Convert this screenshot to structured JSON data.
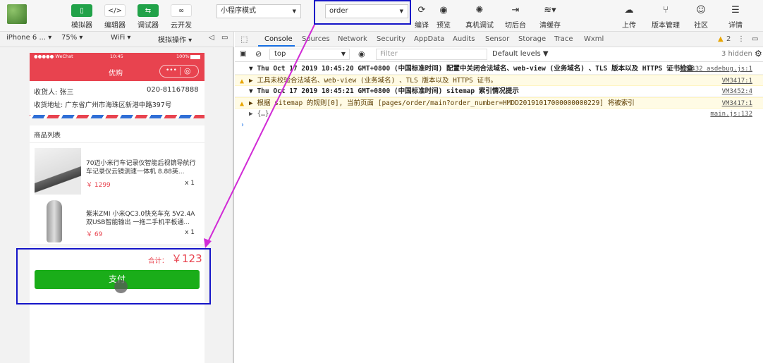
{
  "toolbar": {
    "simulator": "模拟器",
    "editor": "编辑器",
    "debugger": "调试器",
    "cloud": "云开发",
    "mode": "小程序模式",
    "page_select": "order",
    "compile": "编译",
    "preview": "预览",
    "remote_debug": "真机调试",
    "backstage": "切后台",
    "clear_cache": "清缓存",
    "upload": "上传",
    "version": "版本管理",
    "community": "社区",
    "details": "详情"
  },
  "subbar": {
    "device": "iPhone 6 ...",
    "zoom": "75%",
    "network": "WiFi",
    "simulate": "模拟操作"
  },
  "devtools": {
    "tabs": [
      "Console",
      "Sources",
      "Network",
      "Security",
      "AppData",
      "Audits",
      "Sensor",
      "Storage",
      "Trace",
      "Wxml"
    ],
    "warning_count": "2",
    "context": "top",
    "filter_placeholder": "Filter",
    "levels": "Default levels ▼",
    "hidden": "3 hidden"
  },
  "console": [
    {
      "kind": "info",
      "text": "▼ Thu Oct 17 2019 10:45:20 GMT+0800 (中国标准时间) 配置中关闭合法域名、web-view (业务域名) 、TLS 版本以及 HTTPS 证书检查",
      "src": "VM3432 asdebug.js:1"
    },
    {
      "kind": "warn",
      "text": "▶ 工具未校验合法域名、web-view (业务域名) 、TLS 版本以及 HTTPS 证书。",
      "src": "VM3417:1"
    },
    {
      "kind": "info",
      "text": "▼ Thu Oct 17 2019 10:45:21 GMT+0800 (中国标准时间) sitemap 索引情况提示",
      "src": "VM3452:4"
    },
    {
      "kind": "warn",
      "text": "▶ 根据 sitemap 的规则[0], 当前页面 [pages/order/main?order_number=HMDD20191017000000000229] 将被索引",
      "src": "VM3417:1"
    },
    {
      "kind": "plain",
      "text": "▶ {…}",
      "src": "main.js:132"
    }
  ],
  "phone": {
    "carrier": "●●●●● WeChat",
    "time": "10:45",
    "battery": "100%",
    "nav_title": "优购",
    "receiver": "收货人: 张三",
    "phone": "020-81167888",
    "address": "收货地址: 广东省广州市海珠区新港中路397号",
    "list_title": "商品列表",
    "products": [
      {
        "title": "70迈小米行车记录仪智能后视镜导航行车记录仪云镜测速一体机 8.88英...",
        "price": "￥ 1299",
        "qty": "x 1"
      },
      {
        "title": "紫米ZMI 小米QC3.0快充车充 5V2.4A 双USB智能输出 一拖二手机平板通...",
        "price": "￥ 69",
        "qty": "x 1"
      }
    ],
    "total_label": "合计：",
    "total_value": "￥123",
    "pay_button": "支付"
  },
  "colors": {
    "accent_red": "#e8434f",
    "pay_green": "#1aad19",
    "highlight_blue": "#1515c8",
    "arrow_magenta": "#d12bd6"
  }
}
